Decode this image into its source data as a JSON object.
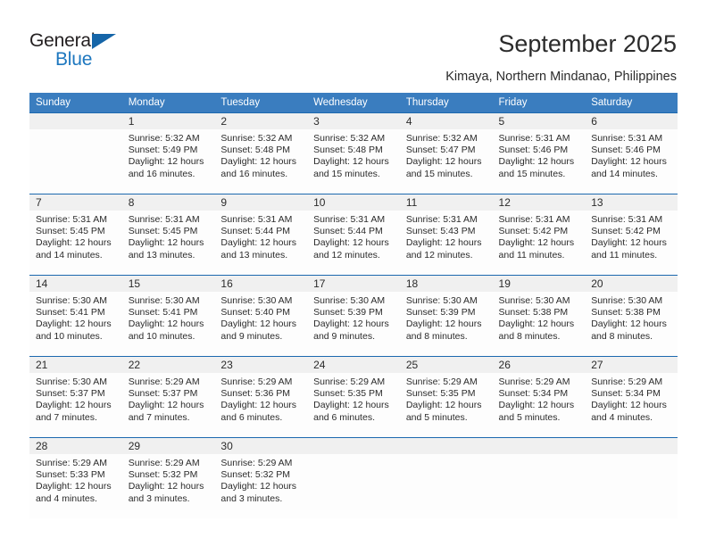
{
  "brand": {
    "name_dark": "General",
    "name_blue": "Blue",
    "accent_color": "#1d77bf",
    "triangle_color": "#1565a8"
  },
  "header": {
    "title": "September 2025",
    "subtitle": "Kimaya, Northern Mindanao, Philippines",
    "header_bg_color": "#3a7dbf",
    "row_border_color": "#1c69af",
    "daynum_band_color": "#f0f0f0"
  },
  "weekdays": [
    "Sunday",
    "Monday",
    "Tuesday",
    "Wednesday",
    "Thursday",
    "Friday",
    "Saturday"
  ],
  "weeks": [
    [
      {
        "day": ""
      },
      {
        "day": "1",
        "sunrise": "Sunrise: 5:32 AM",
        "sunset": "Sunset: 5:49 PM",
        "daylight": "Daylight: 12 hours and 16 minutes."
      },
      {
        "day": "2",
        "sunrise": "Sunrise: 5:32 AM",
        "sunset": "Sunset: 5:48 PM",
        "daylight": "Daylight: 12 hours and 16 minutes."
      },
      {
        "day": "3",
        "sunrise": "Sunrise: 5:32 AM",
        "sunset": "Sunset: 5:48 PM",
        "daylight": "Daylight: 12 hours and 15 minutes."
      },
      {
        "day": "4",
        "sunrise": "Sunrise: 5:32 AM",
        "sunset": "Sunset: 5:47 PM",
        "daylight": "Daylight: 12 hours and 15 minutes."
      },
      {
        "day": "5",
        "sunrise": "Sunrise: 5:31 AM",
        "sunset": "Sunset: 5:46 PM",
        "daylight": "Daylight: 12 hours and 15 minutes."
      },
      {
        "day": "6",
        "sunrise": "Sunrise: 5:31 AM",
        "sunset": "Sunset: 5:46 PM",
        "daylight": "Daylight: 12 hours and 14 minutes."
      }
    ],
    [
      {
        "day": "7",
        "sunrise": "Sunrise: 5:31 AM",
        "sunset": "Sunset: 5:45 PM",
        "daylight": "Daylight: 12 hours and 14 minutes."
      },
      {
        "day": "8",
        "sunrise": "Sunrise: 5:31 AM",
        "sunset": "Sunset: 5:45 PM",
        "daylight": "Daylight: 12 hours and 13 minutes."
      },
      {
        "day": "9",
        "sunrise": "Sunrise: 5:31 AM",
        "sunset": "Sunset: 5:44 PM",
        "daylight": "Daylight: 12 hours and 13 minutes."
      },
      {
        "day": "10",
        "sunrise": "Sunrise: 5:31 AM",
        "sunset": "Sunset: 5:44 PM",
        "daylight": "Daylight: 12 hours and 12 minutes."
      },
      {
        "day": "11",
        "sunrise": "Sunrise: 5:31 AM",
        "sunset": "Sunset: 5:43 PM",
        "daylight": "Daylight: 12 hours and 12 minutes."
      },
      {
        "day": "12",
        "sunrise": "Sunrise: 5:31 AM",
        "sunset": "Sunset: 5:42 PM",
        "daylight": "Daylight: 12 hours and 11 minutes."
      },
      {
        "day": "13",
        "sunrise": "Sunrise: 5:31 AM",
        "sunset": "Sunset: 5:42 PM",
        "daylight": "Daylight: 12 hours and 11 minutes."
      }
    ],
    [
      {
        "day": "14",
        "sunrise": "Sunrise: 5:30 AM",
        "sunset": "Sunset: 5:41 PM",
        "daylight": "Daylight: 12 hours and 10 minutes."
      },
      {
        "day": "15",
        "sunrise": "Sunrise: 5:30 AM",
        "sunset": "Sunset: 5:41 PM",
        "daylight": "Daylight: 12 hours and 10 minutes."
      },
      {
        "day": "16",
        "sunrise": "Sunrise: 5:30 AM",
        "sunset": "Sunset: 5:40 PM",
        "daylight": "Daylight: 12 hours and 9 minutes."
      },
      {
        "day": "17",
        "sunrise": "Sunrise: 5:30 AM",
        "sunset": "Sunset: 5:39 PM",
        "daylight": "Daylight: 12 hours and 9 minutes."
      },
      {
        "day": "18",
        "sunrise": "Sunrise: 5:30 AM",
        "sunset": "Sunset: 5:39 PM",
        "daylight": "Daylight: 12 hours and 8 minutes."
      },
      {
        "day": "19",
        "sunrise": "Sunrise: 5:30 AM",
        "sunset": "Sunset: 5:38 PM",
        "daylight": "Daylight: 12 hours and 8 minutes."
      },
      {
        "day": "20",
        "sunrise": "Sunrise: 5:30 AM",
        "sunset": "Sunset: 5:38 PM",
        "daylight": "Daylight: 12 hours and 8 minutes."
      }
    ],
    [
      {
        "day": "21",
        "sunrise": "Sunrise: 5:30 AM",
        "sunset": "Sunset: 5:37 PM",
        "daylight": "Daylight: 12 hours and 7 minutes."
      },
      {
        "day": "22",
        "sunrise": "Sunrise: 5:29 AM",
        "sunset": "Sunset: 5:37 PM",
        "daylight": "Daylight: 12 hours and 7 minutes."
      },
      {
        "day": "23",
        "sunrise": "Sunrise: 5:29 AM",
        "sunset": "Sunset: 5:36 PM",
        "daylight": "Daylight: 12 hours and 6 minutes."
      },
      {
        "day": "24",
        "sunrise": "Sunrise: 5:29 AM",
        "sunset": "Sunset: 5:35 PM",
        "daylight": "Daylight: 12 hours and 6 minutes."
      },
      {
        "day": "25",
        "sunrise": "Sunrise: 5:29 AM",
        "sunset": "Sunset: 5:35 PM",
        "daylight": "Daylight: 12 hours and 5 minutes."
      },
      {
        "day": "26",
        "sunrise": "Sunrise: 5:29 AM",
        "sunset": "Sunset: 5:34 PM",
        "daylight": "Daylight: 12 hours and 5 minutes."
      },
      {
        "day": "27",
        "sunrise": "Sunrise: 5:29 AM",
        "sunset": "Sunset: 5:34 PM",
        "daylight": "Daylight: 12 hours and 4 minutes."
      }
    ],
    [
      {
        "day": "28",
        "sunrise": "Sunrise: 5:29 AM",
        "sunset": "Sunset: 5:33 PM",
        "daylight": "Daylight: 12 hours and 4 minutes."
      },
      {
        "day": "29",
        "sunrise": "Sunrise: 5:29 AM",
        "sunset": "Sunset: 5:32 PM",
        "daylight": "Daylight: 12 hours and 3 minutes."
      },
      {
        "day": "30",
        "sunrise": "Sunrise: 5:29 AM",
        "sunset": "Sunset: 5:32 PM",
        "daylight": "Daylight: 12 hours and 3 minutes."
      },
      {
        "day": ""
      },
      {
        "day": ""
      },
      {
        "day": ""
      },
      {
        "day": ""
      }
    ]
  ]
}
